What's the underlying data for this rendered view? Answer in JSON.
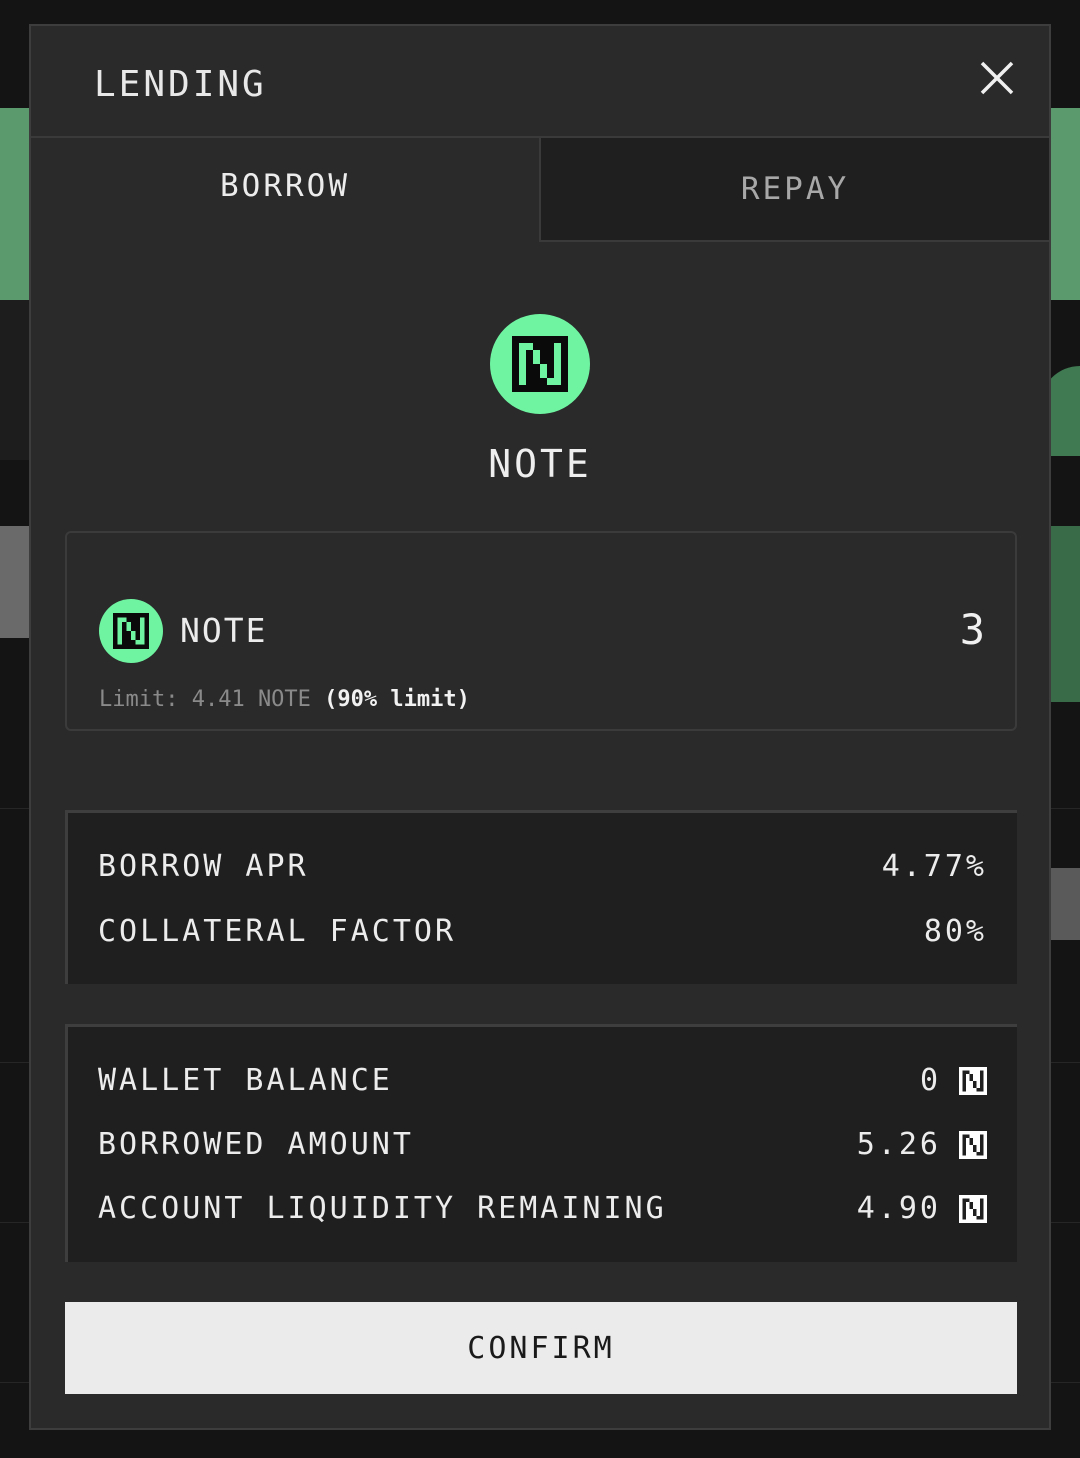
{
  "modal": {
    "title": "LENDING",
    "close_icon": "close-icon"
  },
  "tabs": [
    {
      "label": "BORROW",
      "active": true
    },
    {
      "label": "REPAY",
      "active": false
    }
  ],
  "token": {
    "name": "NOTE",
    "icon": "note-token-icon",
    "color": "#6ff5a2"
  },
  "input": {
    "token_name": "NOTE",
    "amount": "3",
    "limit_prefix": "Limit: 4.41 NOTE",
    "limit_suffix": "(90% limit)"
  },
  "rates": [
    {
      "label": "BORROW APR",
      "value": "4.77%"
    },
    {
      "label": "COLLATERAL FACTOR",
      "value": "80%"
    }
  ],
  "balances": [
    {
      "label": "WALLET BALANCE",
      "value": "0"
    },
    {
      "label": "BORROWED AMOUNT",
      "value": "5.26"
    },
    {
      "label": "ACCOUNT LIQUIDITY REMAINING",
      "value": "4.90"
    }
  ],
  "confirm_label": "CONFIRM"
}
